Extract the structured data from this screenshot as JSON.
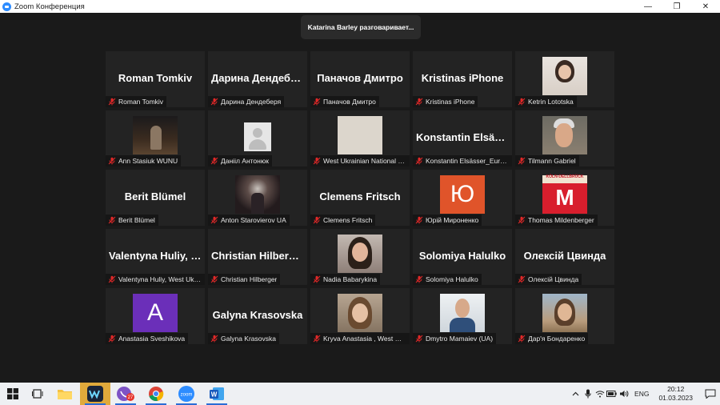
{
  "window": {
    "title": "Zoom Конференция",
    "minimize": "—",
    "maximize": "❐",
    "close": "✕"
  },
  "speaking_banner": "Katarina Barley разговаривает...",
  "tiles": [
    {
      "display": "Roman Tomkiv",
      "label": "Roman Tomkiv",
      "avatar": "none"
    },
    {
      "display": "Дарина Дендеберя",
      "label": "Дарина Дендеберя",
      "avatar": "none"
    },
    {
      "display": "Паначов Дмитро",
      "label": "Паначов Дмитро",
      "avatar": "none"
    },
    {
      "display": "Kristinas iPhone",
      "label": "Kristinas iPhone",
      "avatar": "none"
    },
    {
      "display": "",
      "label": "Ketrin Lototska",
      "avatar": "photo-woman"
    },
    {
      "display": "",
      "label": "Ann Stasiuk WUNU",
      "avatar": "night"
    },
    {
      "display": "",
      "label": "Данііл Антонюк",
      "avatar": "default"
    },
    {
      "display": "",
      "label": "West Ukrainian National University",
      "avatar": "beige"
    },
    {
      "display": "Konstantin Elsässer",
      "label": "Konstantin Elsässer_Europa",
      "avatar": "none"
    },
    {
      "display": "",
      "label": "Tilmann Gabriel",
      "avatar": "man-gray"
    },
    {
      "display": "Berit Blümel",
      "label": "Berit Blümel",
      "avatar": "none"
    },
    {
      "display": "",
      "label": "Anton Starovierov UA",
      "avatar": "tunnel"
    },
    {
      "display": "Clemens Fritsch",
      "label": "Clemens Fritsch",
      "avatar": "none"
    },
    {
      "display": "",
      "label": "Юрій Мироненко",
      "avatar": "letter-orange",
      "letter": "Ю"
    },
    {
      "display": "",
      "label": "Thomas Mildenberger",
      "avatar": "red-poster",
      "poster_top": "KÖLN-DELLBRÜCK",
      "poster_letter": "M"
    },
    {
      "display": "Valentyna Huliy, West Ukrainian",
      "label": "Valentyna Huliy, West Ukrainian",
      "avatar": "none"
    },
    {
      "display": "Christian Hilberger",
      "label": "Christian Hilberger",
      "avatar": "none"
    },
    {
      "display": "",
      "label": "Nadia Babarykina",
      "avatar": "woman-dark"
    },
    {
      "display": "Solomiya Halulko",
      "label": "Solomiya Halulko",
      "avatar": "none"
    },
    {
      "display": "Олексій Цвинда",
      "label": "Олексій Цвинда",
      "avatar": "none"
    },
    {
      "display": "",
      "label": "Anastasia Sveshikova",
      "avatar": "letter-purple",
      "letter": "A"
    },
    {
      "display": "Galyna Krasovska",
      "label": "Galyna Krasovska",
      "avatar": "none"
    },
    {
      "display": "",
      "label": "Kryva Anastasia , West Ukrainian",
      "avatar": "woman-blonde"
    },
    {
      "display": "",
      "label": "Dmytro Mamaiev (UA)",
      "avatar": "man-suit"
    },
    {
      "display": "",
      "label": "Дар'я Бондаренко",
      "avatar": "girl-outdoor"
    }
  ],
  "taskbar": {
    "apps": [
      {
        "name": "file-explorer-icon"
      },
      {
        "name": "wondershare-icon"
      },
      {
        "name": "viber-icon",
        "badge": "27"
      },
      {
        "name": "chrome-icon"
      },
      {
        "name": "zoom-icon",
        "text": "zoom"
      },
      {
        "name": "word-icon",
        "text": "W"
      }
    ],
    "lang": "ENG",
    "time": "20:12",
    "date": "01.03.2023"
  },
  "colors": {
    "zoom_blue": "#2d8cff",
    "mic_red": "#e02828",
    "stage_bg": "#1a1a1a",
    "tile_bg": "#232323"
  }
}
